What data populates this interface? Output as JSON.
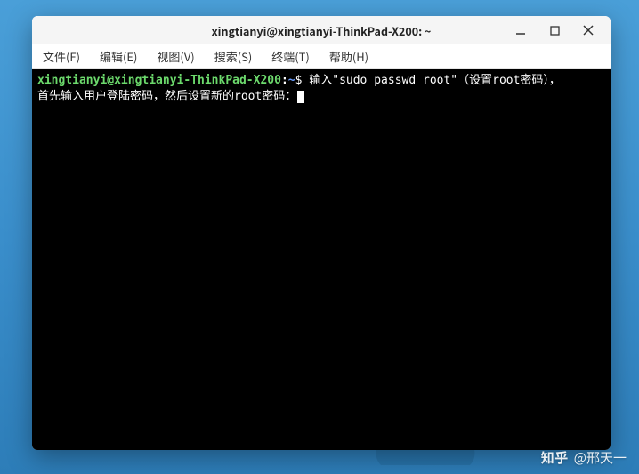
{
  "window": {
    "title": "xingtianyi@xingtianyi-ThinkPad-X200: ~"
  },
  "menu": {
    "file": "文件(F)",
    "edit": "编辑(E)",
    "view": "视图(V)",
    "search": "搜索(S)",
    "terminal": "终端(T)",
    "help": "帮助(H)"
  },
  "prompt": {
    "user": "xingtianyi@xingtianyi-ThinkPad-X200",
    "colon": ":",
    "path": "~",
    "symbol": "$"
  },
  "terminal_text": {
    "line1_cmd": " 输入\"sudo passwd root\"（设置root密码），",
    "line2": "首先输入用户登陆密码，然后设置新的root密码："
  },
  "watermark": {
    "logo": "知乎",
    "author": "@邢天一"
  }
}
